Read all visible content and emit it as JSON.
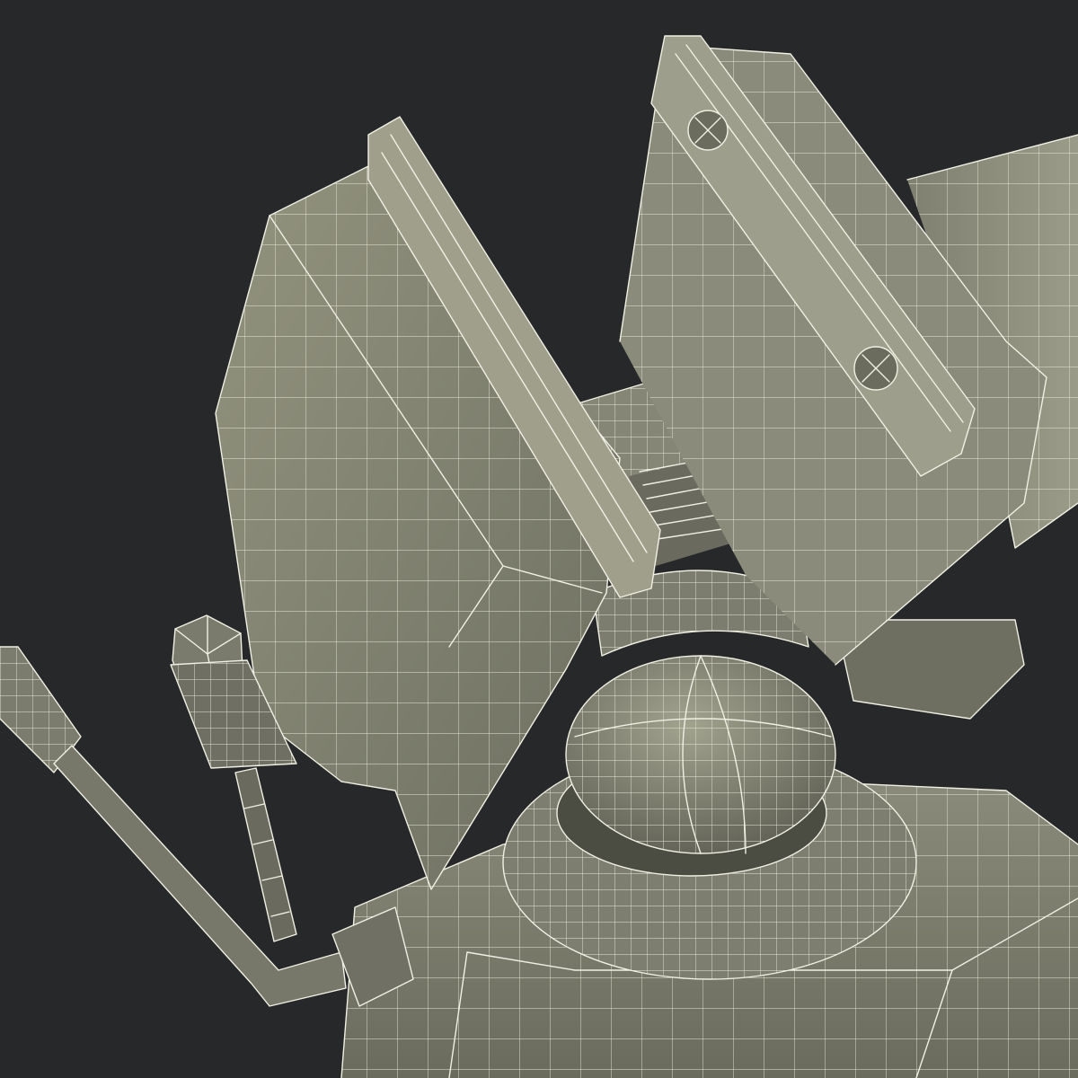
{
  "scene": {
    "subject": "bench-vise-wireframe",
    "colors": {
      "background": "#26282a",
      "surface_light": "#8c8d7d",
      "surface_mid": "#7a7b6c",
      "surface_dark": "#5e5f53",
      "surface_shadow": "#45463d",
      "wire": "#f1f0e4"
    },
    "icons": [
      "screw-head-icon",
      "screw-head-icon"
    ]
  }
}
